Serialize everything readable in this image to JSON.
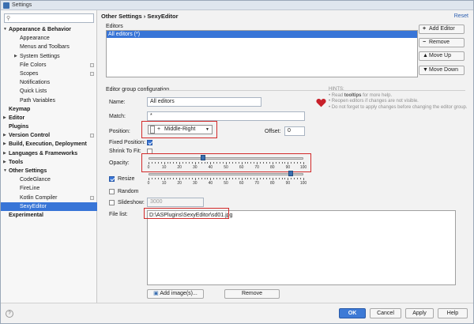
{
  "window": {
    "title": "Settings"
  },
  "sidebar": {
    "items": [
      {
        "label": "Appearance & Behavior",
        "bold": true,
        "level": 0,
        "expanded": true
      },
      {
        "label": "Appearance",
        "level": 1
      },
      {
        "label": "Menus and Toolbars",
        "level": 1
      },
      {
        "label": "System Settings",
        "level": 1,
        "collapsed": true
      },
      {
        "label": "File Colors",
        "level": 1,
        "projIcon": true
      },
      {
        "label": "Scopes",
        "level": 1,
        "projIcon": true
      },
      {
        "label": "Notifications",
        "level": 1
      },
      {
        "label": "Quick Lists",
        "level": 1
      },
      {
        "label": "Path Variables",
        "level": 1
      },
      {
        "label": "Keymap",
        "bold": true,
        "level": 0
      },
      {
        "label": "Editor",
        "bold": true,
        "level": 0,
        "collapsed": true
      },
      {
        "label": "Plugins",
        "bold": true,
        "level": 0
      },
      {
        "label": "Version Control",
        "bold": true,
        "level": 0,
        "collapsed": true,
        "projIcon": true
      },
      {
        "label": "Build, Execution, Deployment",
        "bold": true,
        "level": 0,
        "collapsed": true
      },
      {
        "label": "Languages & Frameworks",
        "bold": true,
        "level": 0,
        "collapsed": true
      },
      {
        "label": "Tools",
        "bold": true,
        "level": 0,
        "collapsed": true
      },
      {
        "label": "Other Settings",
        "bold": true,
        "level": 0,
        "expanded": true
      },
      {
        "label": "CodeGlance",
        "level": 1
      },
      {
        "label": "FireLine",
        "level": 1
      },
      {
        "label": "Kotlin Compiler",
        "level": 1,
        "projIcon": true
      },
      {
        "label": "SexyEditor",
        "level": 1,
        "selected": true
      },
      {
        "label": "Experimental",
        "bold": true,
        "level": 0
      }
    ]
  },
  "header": {
    "breadcrumb": "Other Settings › SexyEditor",
    "reset": "Reset"
  },
  "editors": {
    "label": "Editors",
    "rows": [
      "All editors (*)"
    ],
    "buttons": {
      "add": "Add Editor",
      "remove": "Remove",
      "up": "Move Up",
      "down": "Move Down"
    }
  },
  "group": {
    "title": "Editor group configuration",
    "name_label": "Name:",
    "name_value": "All editors",
    "match_label": "Match:",
    "match_value": "*",
    "position_label": "Position:",
    "position_value": "Middle-Right",
    "offset_label": "Offset:",
    "offset_value": "0",
    "fixed_label": "Fixed Position:",
    "fixed_checked": true,
    "shrink_label": "Shrink To Fit:",
    "shrink_checked": false,
    "opacity_label": "Opacity:",
    "opacity_value": 35,
    "tick_labels": [
      "0",
      "10",
      "20",
      "30",
      "40",
      "50",
      "60",
      "70",
      "80",
      "90",
      "100"
    ],
    "resize_label": "Resize",
    "resize_checked": true,
    "resize_value": 92,
    "random_label": "Random",
    "random_checked": false,
    "slideshow_label": "Slideshow:",
    "slideshow_checked": false,
    "slideshow_value": "3000",
    "filelist_label": "File list:",
    "filelist_items": [
      "D:\\ASPlugins\\SexyEditor\\sd01.jpg"
    ],
    "add_images": "Add image(s)...",
    "remove_images": "Remove"
  },
  "hints": {
    "title": "HINTS:",
    "line1_pre": "• Read ",
    "line1_hl": "tooltips",
    "line1_post": " for more help.",
    "line2": "• Reopen editors if changes are not visible.",
    "line3": "• Do not forget to apply changes before changing the editor group."
  },
  "footer": {
    "ok": "OK",
    "cancel": "Cancel",
    "apply": "Apply",
    "help": "Help",
    "help_icon": "?"
  },
  "colors": {
    "accent": "#3875d7",
    "highlight": "#d22a2a",
    "heart": "#c8202a"
  }
}
